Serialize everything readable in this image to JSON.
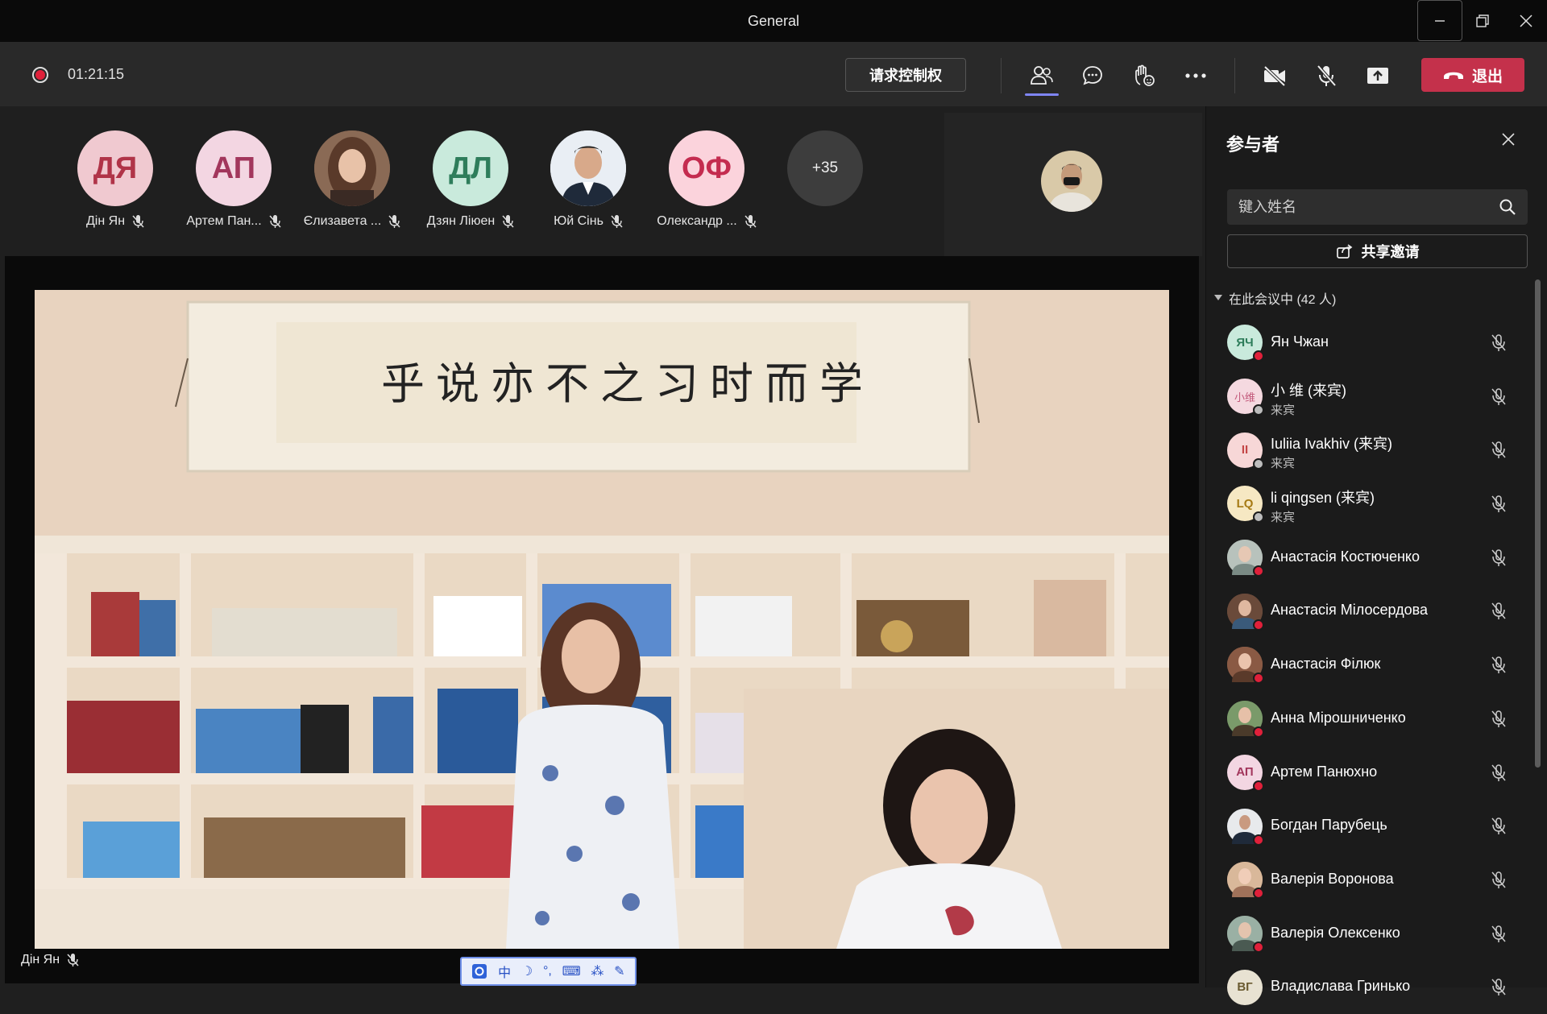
{
  "window": {
    "title": "General"
  },
  "toolbar": {
    "timer": "01:21:15",
    "request_control": "请求控制权",
    "leave": "退出"
  },
  "strip": {
    "participants": [
      {
        "initials": "ДЯ",
        "name": "Дін Ян",
        "color": "#f0c9d0",
        "text_color": "#b03448"
      },
      {
        "initials": "АП",
        "name": "Артем Пан...",
        "color": "#f3d6e2",
        "text_color": "#a2365c"
      },
      {
        "initials": "",
        "name": "Єлизавета ...",
        "photo": true
      },
      {
        "initials": "ДЛ",
        "name": "Дзян Ліюен",
        "color": "#c9eadc",
        "text_color": "#2e7d5b"
      },
      {
        "initials": "",
        "name": "Юй Сінь",
        "photo": true
      },
      {
        "initials": "ОФ",
        "name": "Олександр ...",
        "color": "#fbd3dc",
        "text_color": "#c42b4f"
      }
    ],
    "more": "+35"
  },
  "stage": {
    "speaker": "Дін Ян",
    "calligraphy": "学而时习之不亦说乎",
    "ime_items": [
      "中",
      "☽",
      "°,",
      "⌨",
      "⁂",
      "✎"
    ]
  },
  "panel": {
    "title": "参与者",
    "search_placeholder": "键入姓名",
    "invite": "共享邀请",
    "section": "在此会议中 (42 人)",
    "people": [
      {
        "initials": "ЯЧ",
        "name": "Ян Чжан",
        "sub": "",
        "bg": "#c9eadc",
        "fg": "#2e7d5b",
        "guest": false
      },
      {
        "initials": "小维",
        "name": "小 维 (来宾)",
        "sub": "来宾",
        "bg": "#f5d9e0",
        "fg": "#c2587a",
        "guest": true
      },
      {
        "initials": "II",
        "name": "Iuliia Ivakhiv (来宾)",
        "sub": "来宾",
        "bg": "#f7d7d7",
        "fg": "#c44747",
        "guest": true
      },
      {
        "initials": "LQ",
        "name": "li qingsen (来宾)",
        "sub": "来宾",
        "bg": "#f6e8c3",
        "fg": "#a67a14",
        "guest": true
      },
      {
        "initials": "",
        "name": "Анастасія Костюченко",
        "sub": "",
        "photo": "#9aa7a0",
        "guest": false
      },
      {
        "initials": "",
        "name": "Анастасія Мілосердова",
        "sub": "",
        "photo": "#7a5040",
        "guest": false
      },
      {
        "initials": "",
        "name": "Анастасія Філюк",
        "sub": "",
        "photo": "#a0735a",
        "guest": false
      },
      {
        "initials": "",
        "name": "Анна Мірошниченко",
        "sub": "",
        "photo": "#6b8d5a",
        "guest": false
      },
      {
        "initials": "АП",
        "name": "Артем Панюхно",
        "sub": "",
        "bg": "#f3d6e2",
        "fg": "#a2365c",
        "guest": false
      },
      {
        "initials": "",
        "name": "Богдан Парубець",
        "sub": "",
        "photo": "#3d4a5a",
        "guest": false
      },
      {
        "initials": "",
        "name": "Валерія Воронова",
        "sub": "",
        "photo": "#c49a7a",
        "guest": false
      },
      {
        "initials": "",
        "name": "Валерія Олексенко",
        "sub": "",
        "photo": "#7f9a8a",
        "guest": false
      },
      {
        "initials": "ВГ",
        "name": "Владислава Гринько",
        "sub": "",
        "bg": "#e8e2d2",
        "fg": "#6a5a30",
        "guest": false
      }
    ]
  }
}
